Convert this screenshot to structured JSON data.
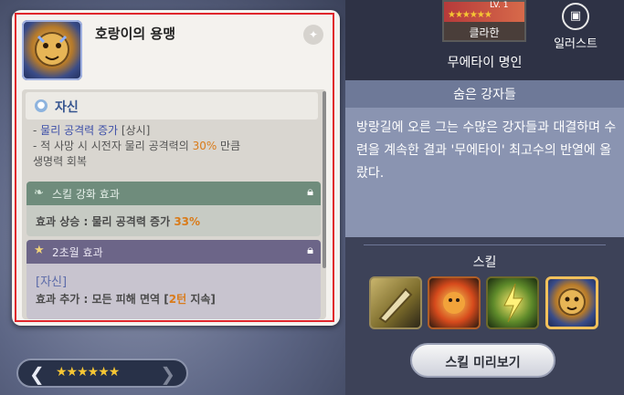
{
  "tooltip": {
    "skill_name": "호랑이의 용맹",
    "pin_icon": "pin-icon",
    "skill_type": "자신",
    "description": {
      "line1_prefix": "- ",
      "line1_highlight": "물리 공격력 증가",
      "line1_suffix": " [상시]",
      "line2_prefix": "- 적 사망 시 시전자 물리 공격력의 ",
      "line2_value": "30%",
      "line2_suffix": " 만큼",
      "line3": "생명력 회복"
    },
    "enhance_effect": {
      "title": "스킬 강화 효과",
      "text_prefix": "효과 상승 : 물리 공격력 증가 ",
      "text_value": "33%",
      "lock_icon": "lock-icon"
    },
    "transcend_effect": {
      "title": "2초월 효과",
      "line1": "[자신]",
      "line2_prefix": "효과 추가 : 모든 피해 면역 [",
      "line2_value": "2턴",
      "line2_suffix": " 지속]",
      "lock_icon": "lock-icon"
    }
  },
  "star_nav": {
    "prev_glyph": "❮",
    "next_glyph": "❯",
    "stars": "★★★★★★",
    "star_count": 6
  },
  "character": {
    "card_level": "LV. 1",
    "card_stars": "★★★★★★",
    "name": "클라한",
    "illustration_label": "일러스트",
    "epithet": "무에타이 명인"
  },
  "story": {
    "title": "숨은 강자들",
    "text": "방랑길에 오른 그는 수많은 강자들과 대결하며 수련을 계속한 결과 '무에타이' 최고수의 반열에 올랐다."
  },
  "skills": {
    "label": "스킬",
    "slots": [
      "blade-skill-icon",
      "fire-beast-skill-icon",
      "lightning-skill-icon",
      "tiger-valor-skill-icon"
    ],
    "selected_index": 3
  },
  "preview_button": {
    "label": "스킬 미리보기"
  },
  "colors": {
    "highlight_orange": "#d97b1a",
    "highlight_blue": "#3d4fa8",
    "outline_red": "#e0262c",
    "star_gold": "#f6c634"
  }
}
